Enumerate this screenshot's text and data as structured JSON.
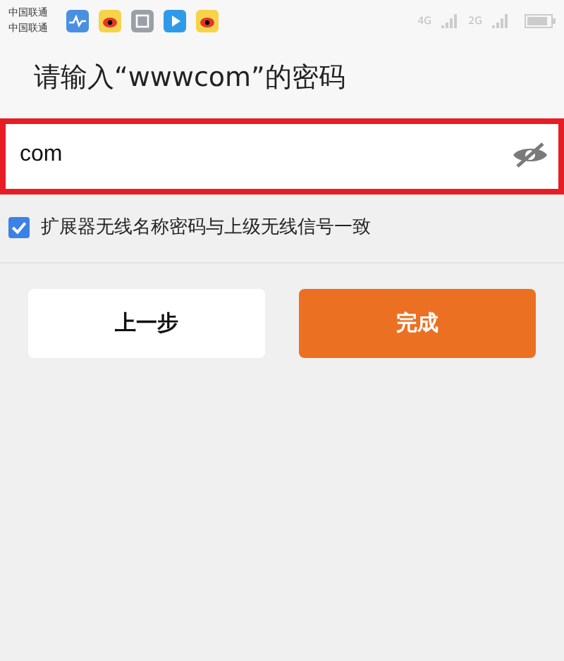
{
  "status_bar": {
    "carriers": [
      "中国联通",
      "中国联通"
    ],
    "network_labels": [
      "4G",
      "2G"
    ]
  },
  "title": "请输入“wwwcom”的密码",
  "password_field": {
    "value": "com",
    "highlighted": true
  },
  "sync_option": {
    "label": "扩展器无线名称密码与上级无线信号一致",
    "checked": true
  },
  "buttons": [
    {
      "label": "上一步",
      "kind": "secondary"
    },
    {
      "label": "完成",
      "kind": "primary"
    }
  ]
}
